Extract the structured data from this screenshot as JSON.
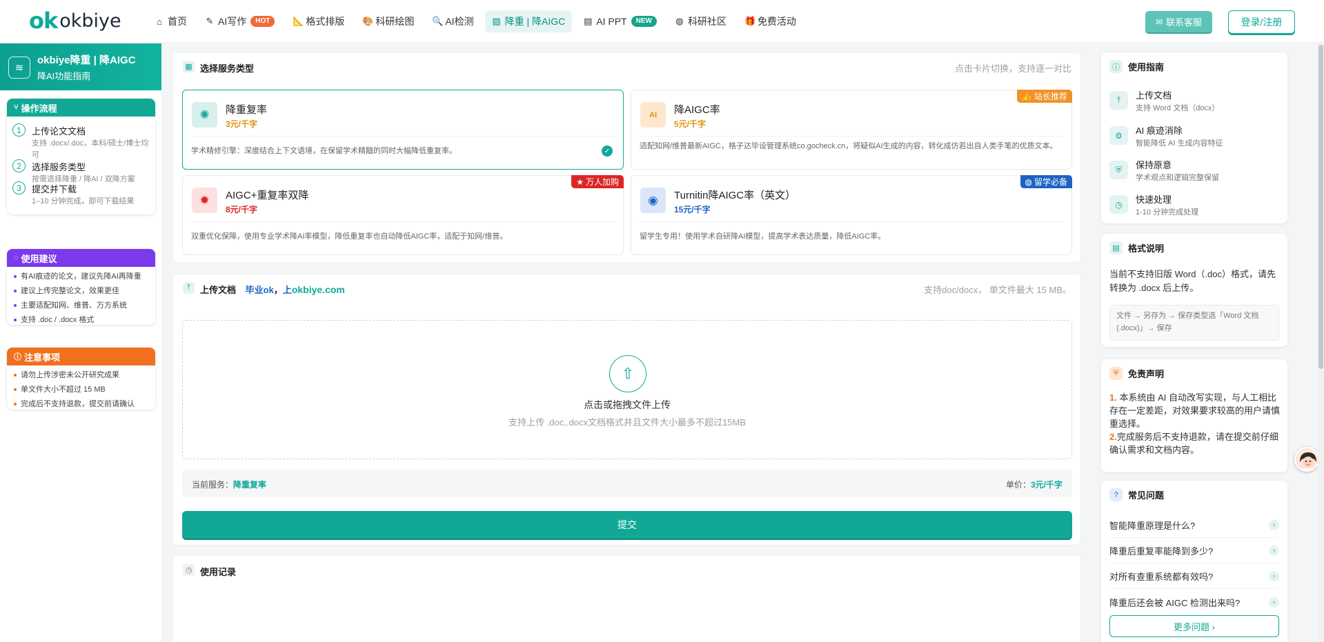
{
  "brand": {
    "logo_mark": "ok",
    "logo_text": "okbiye"
  },
  "nav": {
    "items": [
      {
        "label": "首页",
        "icon": "home-icon",
        "glyph": "⌂"
      },
      {
        "label": "AI写作",
        "icon": "pen-icon",
        "glyph": "✎",
        "badge": "HOT"
      },
      {
        "label": "格式排版",
        "icon": "ruler-icon",
        "glyph": "📐"
      },
      {
        "label": "科研绘图",
        "icon": "palette-icon",
        "glyph": "🎨"
      },
      {
        "label": "AI检测",
        "icon": "search-icon",
        "glyph": "🔍"
      },
      {
        "label": "降重 | 降AIGC",
        "icon": "edit-box-icon",
        "glyph": "▨"
      },
      {
        "label": "AI PPT",
        "icon": "slides-icon",
        "glyph": "▤",
        "badge": "NEW"
      },
      {
        "label": "科研社区",
        "icon": "globe-icon",
        "glyph": "◍"
      },
      {
        "label": "免费活动",
        "icon": "gift-icon",
        "glyph": "🎁"
      }
    ],
    "contact_label": "联系客服",
    "login_label": "登录/注册"
  },
  "left": {
    "head_title": "okbiye降重 | 降AIGC",
    "head_sub": "降AI功能指南",
    "flow": {
      "title": "操作流程",
      "steps": [
        {
          "num": "1",
          "title": "上传论文文档",
          "desc": "支持 .docx/.doc，本科/硕士/博士均可"
        },
        {
          "num": "2",
          "title": "选择服务类型",
          "desc": "按需选择降重 / 降AI / 双降方案"
        },
        {
          "num": "3",
          "title": "提交并下载",
          "desc": "1–10 分钟完成，即可下载结果"
        }
      ]
    },
    "tips": {
      "title": "使用建议",
      "items": [
        "有AI痕迹的论文，建议先降AI再降重",
        "建议上传完整论文，效果更佳",
        "主要适配知网、维普、万方系统",
        "支持 .doc / .docx 格式"
      ]
    },
    "notes": {
      "title": "注意事项",
      "items": [
        "请勿上传涉密未公开研究成果",
        "单文件大小不超过 15 MB",
        "完成后不支持退款，提交前请确认"
      ]
    }
  },
  "service": {
    "title": "选择服务类型",
    "hint": "点击卡片切换，支持逐一对比",
    "cards": [
      {
        "name": "降重复率",
        "price": "3元/千字",
        "desc": "学术精修引擎：深度结合上下文语境，在保留学术精髓的同时大幅降低重复率。",
        "selected": true,
        "price_color": "#e0900f"
      },
      {
        "name": "降AIGC率",
        "price": "5元/千字",
        "desc": "适配知网/维普最新AIGC，格子达毕设管理系统co.gocheck.cn，将疑似AI生成的内容，转化成仿若出自人类手笔的优质文本。",
        "ribbon": "站长推荐",
        "ribbon_color": "#f0922a",
        "price_color": "#e0900f"
      },
      {
        "name": "AIGC+重复率双降",
        "price": "8元/千字",
        "desc": "双重优化保障，使用专业学术降AI率模型，降低重复率也自动降低AIGC率，适配于知网/维普。",
        "ribbon": "万人加购",
        "ribbon_color": "#dc2626",
        "price_color": "#dc2626"
      },
      {
        "name": "Turnitin降AIGC率（英文）",
        "price": "15元/千字",
        "desc": "留学生专用！使用学术自研降AI模型，提高学术表达质量，降低AIGC率。",
        "ribbon": "留学必备",
        "ribbon_color": "#1d63c4",
        "price_color": "#1d63c4"
      }
    ]
  },
  "upload": {
    "title": "上传文档",
    "site_a": "毕业ok",
    "sep": "，",
    "site_b_prefix": "上",
    "site_b": "okbiye.com",
    "hint": "支持doc/docx， 单文件最大 15 MB。",
    "drop_title": "点击或拖拽文件上传",
    "drop_sub": "支持上传 .doc,.docx文档格式并且文件大小最多不超过15MB"
  },
  "current": {
    "label": "当前服务：",
    "service": "降重复率",
    "price_label": "单价：",
    "price": "3元/千字"
  },
  "submit_label": "提交",
  "records_title": "使用记录",
  "right": {
    "guide": {
      "title": "使用指南",
      "items": [
        {
          "title": "上传文档",
          "desc": "支持 Word 文档（docx）",
          "icon": "upload-icon",
          "glyph": "⤒"
        },
        {
          "title": "AI 痕迹消除",
          "desc": "智能降低 AI 生成内容特征",
          "icon": "robot-icon",
          "glyph": "⚙"
        },
        {
          "title": "保持原意",
          "desc": "学术观点和逻辑完整保留",
          "icon": "shield-icon",
          "glyph": "⛨"
        },
        {
          "title": "快速处理",
          "desc": "1-10 分钟完成处理",
          "icon": "clock-icon",
          "glyph": "◷"
        }
      ]
    },
    "format": {
      "title": "格式说明",
      "text": "当前不支持旧版 Word（.doc）格式，请先转换为 .docx 后上传。",
      "steps": "文件 → 另存为 → 保存类型选「Word 文档 (.docx)」→ 保存"
    },
    "disclaimer": {
      "title": "免责声明",
      "n1": "1.",
      "t1": " 本系统由 AI 自动改写实现，与人工相比存在一定差距，对效果要求较高的用户请慎重选择。",
      "n2": "2.",
      "t2": "完成服务后不支持退款，请在提交前仔细确认需求和文档内容。"
    },
    "faq": {
      "title": "常见问题",
      "items": [
        "智能降重原理是什么?",
        "降重后重复率能降到多少?",
        "对所有查重系统都有效吗?",
        "降重后还会被 AIGC 检测出来吗?"
      ],
      "more_label": "更多问题 ›"
    }
  },
  "colors": {
    "accent": "#11a896",
    "hot": "#f06a3a",
    "new": "#17a589",
    "purple": "#7c3aed",
    "orange": "#f07020"
  }
}
